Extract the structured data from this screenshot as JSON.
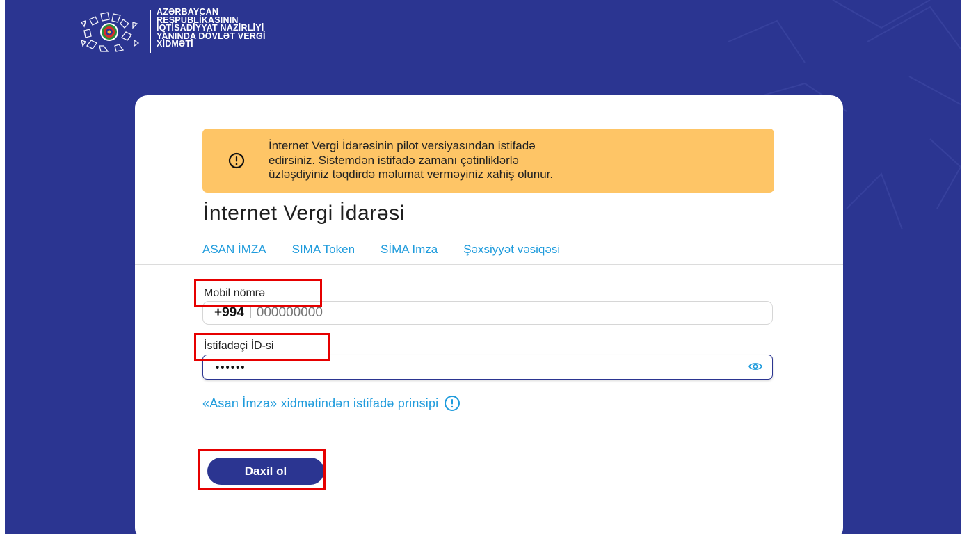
{
  "header": {
    "org_lines": [
      "AZƏRBAYCAN",
      "RESPUBLİKASININ",
      "İQTİSADİYYAT NAZİRLİYİ",
      "YANINDA DÖVLƏT VERGİ",
      "XİDMƏTİ"
    ],
    "emblem_icon": "azerbaijan-emblem-icon"
  },
  "alert": {
    "icon": "exclamation-circle-icon",
    "lines": [
      "İnternet Vergi İdarəsinin pilot versiyasından istifadə",
      "edirsiniz. Sistemdən istifadə zamanı çətinliklərlə",
      "üzləşdiyiniz təqdirdə məlumat verməyiniz xahiş olunur."
    ]
  },
  "title": "İnternet Vergi İdarəsi",
  "tabs": [
    {
      "label": "ASAN İMZA"
    },
    {
      "label": "SIMA Token"
    },
    {
      "label": "SİMA Imza"
    },
    {
      "label": "Şəxsiyyət vəsiqəsi"
    }
  ],
  "form": {
    "phone_label": "Mobil nömrə",
    "phone_prefix": "+994",
    "phone_placeholder": "000000000",
    "user_id_label": "İstifadəçi İD-si",
    "user_id_value": "••••••",
    "eye_icon": "eye-icon",
    "info_link": "«Asan İmza» xidmətindən istifadə prinsipi",
    "info_icon": "info-circle-icon",
    "submit_label": "Daxil ol"
  },
  "colors": {
    "background": "#2b3591",
    "alert": "#fec566",
    "accent_link": "#1e9bdc",
    "button": "#2b3591",
    "highlight": "#e60000"
  }
}
